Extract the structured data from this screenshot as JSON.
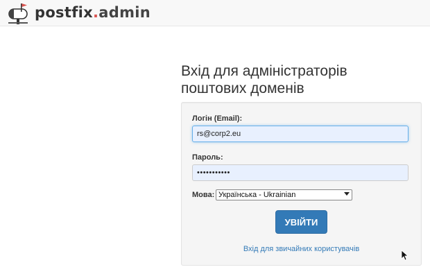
{
  "header": {
    "brand_main": "postfix",
    "brand_dot": ".",
    "brand_sub": "admin"
  },
  "login": {
    "title_line1": "Вхід для адміністраторів",
    "title_line2": "поштових доменів",
    "login_label": "Логін (Email):",
    "login_value": "rs@corp2.eu",
    "password_label": "Пароль:",
    "password_value": "•••••••••••",
    "language_label": "Мова:",
    "language_selected": "Українська - Ukrainian",
    "submit_label": "УВІЙТИ",
    "user_link": "Вхід для звичайних користувачів"
  },
  "colors": {
    "accent": "#337ab7",
    "brand_dot": "#d9534f",
    "input_bg": "#e8f0fe"
  }
}
